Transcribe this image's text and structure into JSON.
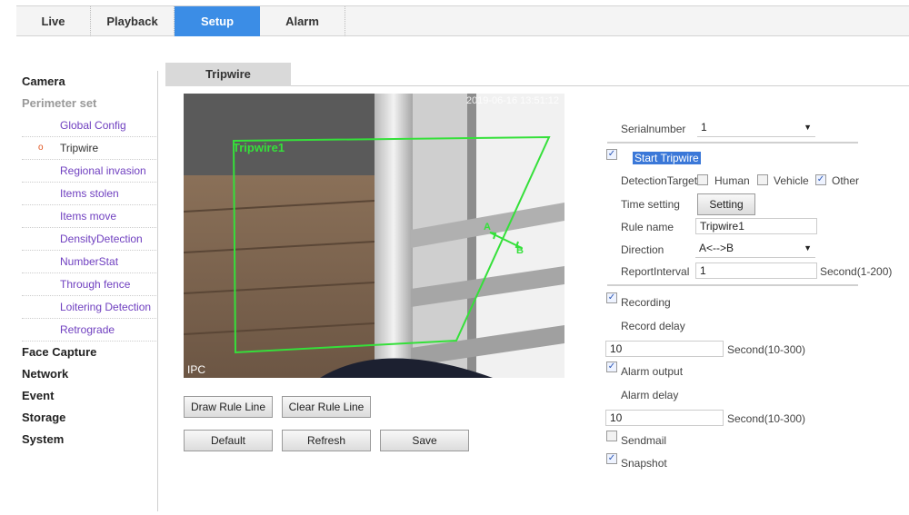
{
  "topnav": {
    "tabs": [
      {
        "label": "Live"
      },
      {
        "label": "Playback"
      },
      {
        "label": "Setup"
      },
      {
        "label": "Alarm"
      }
    ]
  },
  "sidebar": {
    "camera": "Camera",
    "perimeter": "Perimeter set",
    "items": [
      {
        "label": "Global Config"
      },
      {
        "label": "Tripwire"
      },
      {
        "label": "Regional invasion"
      },
      {
        "label": "Items stolen"
      },
      {
        "label": "Items move"
      },
      {
        "label": "DensityDetection"
      },
      {
        "label": "NumberStat"
      },
      {
        "label": "Through fence"
      },
      {
        "label": "Loitering Detection"
      },
      {
        "label": "Retrograde"
      }
    ],
    "bottom": [
      {
        "label": "Face Capture"
      },
      {
        "label": "Network"
      },
      {
        "label": "Event"
      },
      {
        "label": "Storage"
      },
      {
        "label": "System"
      }
    ],
    "marker": "o"
  },
  "content": {
    "tab_label": "Tripwire",
    "video": {
      "timestamp": "2019-06-16 13:51:12",
      "rule_label": "Tripwire1",
      "channel_label": "IPC",
      "dir_a": "A",
      "dir_b": "B"
    },
    "buttons": {
      "draw": "Draw Rule Line",
      "clear": "Clear Rule Line",
      "default": "Default",
      "refresh": "Refresh",
      "save": "Save"
    }
  },
  "form": {
    "serial_label": "Serialnumber",
    "serial_value": "1",
    "start_label": "Start Tripwire",
    "detection_label": "DetectionTarget",
    "human": "Human",
    "vehicle": "Vehicle",
    "other": "Other",
    "time_label": "Time setting",
    "setting_button": "Setting",
    "rule_name_label": "Rule name",
    "rule_name_value": "Tripwire1",
    "direction_label": "Direction",
    "direction_value": "A<-->B",
    "report_label": "ReportInterval",
    "report_value": "1",
    "report_unit": "Second(1-200)",
    "recording_label": "Recording",
    "record_delay_label": "Record delay",
    "record_delay_value": "10",
    "record_delay_unit": "Second(10-300)",
    "alarm_output_label": "Alarm output",
    "alarm_delay_label": "Alarm delay",
    "alarm_delay_value": "10",
    "alarm_delay_unit": "Second(10-300)",
    "sendmail_label": "Sendmail",
    "snapshot_label": "Snapshot",
    "check_mark": "✓",
    "dropdown_arrow": "▼"
  },
  "colors": {
    "accent": "#3b8de6",
    "menu_link": "#7040c0",
    "tripwire_line": "#35e03a"
  }
}
